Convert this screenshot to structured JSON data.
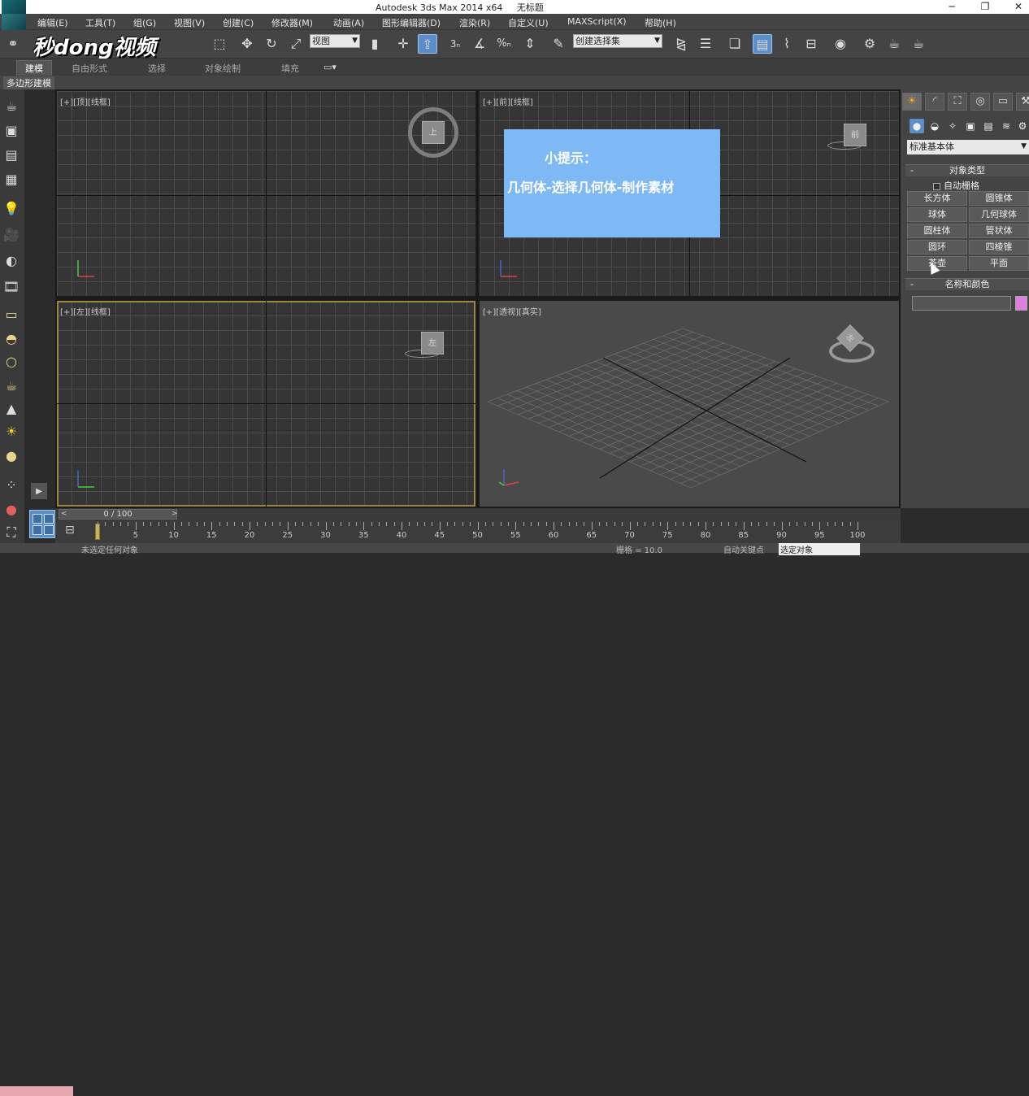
{
  "window": {
    "title": "Autodesk 3ds Max  2014 x64",
    "doc_title": "无标题",
    "minimize": "─",
    "restore": "❐",
    "close": "✕"
  },
  "menu": [
    "编辑(E)",
    "工具(T)",
    "组(G)",
    "视图(V)",
    "创建(C)",
    "修改器(M)",
    "动画(A)",
    "图形编辑器(D)",
    "渲染(R)",
    "自定义(U)",
    "MAXScript(X)",
    "帮助(H)"
  ],
  "toolbar": {
    "view_select": "视图",
    "selection_set": "创建选择集",
    "snap_3": "3",
    "snap_pct": "%"
  },
  "watermark": "秒dong视频",
  "ribbon": {
    "tabs": [
      "建模",
      "自由形式",
      "选择",
      "对象绘制",
      "填充"
    ],
    "active": "建模",
    "sub_tab": "多边形建模"
  },
  "viewports": [
    {
      "label": "[+][顶][线框]",
      "cube_label": "上"
    },
    {
      "label": "[+][前][线框]",
      "cube_label": "前"
    },
    {
      "label": "[+][左][线框]",
      "cube_label": "左"
    },
    {
      "label": "[+][透视][真实]",
      "cube_label": "左"
    }
  ],
  "tip": {
    "title": "小提示：",
    "body": "几何体-选择几何体-制作素材"
  },
  "command_panel": {
    "dropdown": "标准基本体",
    "object_type_header": "对象类型",
    "autogrid": "自动栅格",
    "buttons": [
      "长方体",
      "圆锥体",
      "球体",
      "几何球体",
      "圆柱体",
      "管状体",
      "圆环",
      "四棱锥",
      "茶壶",
      "平面"
    ],
    "name_color_header": "名称和颜色",
    "swatch_color": "#e07ee0",
    "collapse_symbol": "-"
  },
  "timeline": {
    "frame_display": "0 / 100",
    "ticks": [
      5,
      10,
      15,
      20,
      25,
      30,
      35,
      40,
      45,
      50,
      55,
      60,
      65,
      70,
      75,
      80,
      85,
      90,
      95,
      100
    ]
  },
  "status": {
    "message": "未选定任何对象",
    "grid": "栅格 = 10.0",
    "auto_key": "自动关键点",
    "selected": "选定对象"
  }
}
